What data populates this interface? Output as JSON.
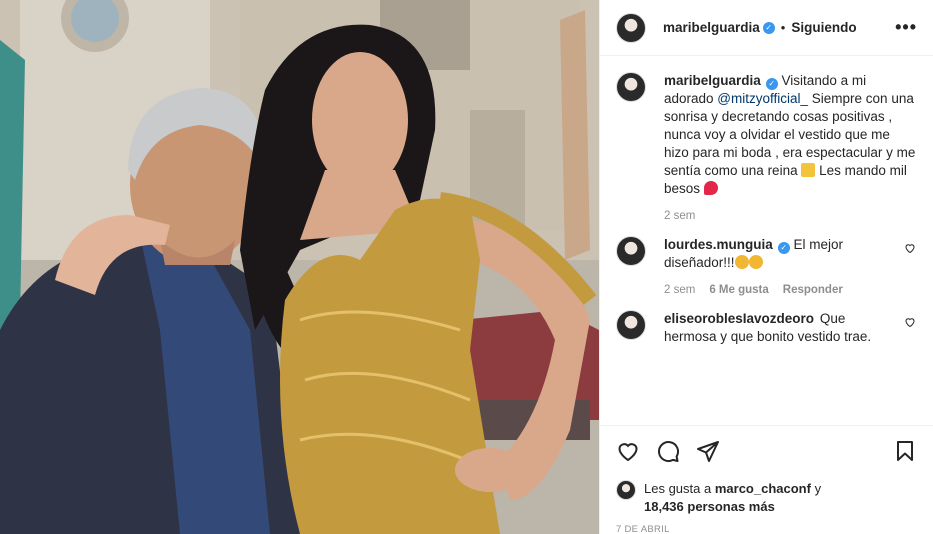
{
  "post": {
    "author": "maribelguardia",
    "follow_status": "Siguiendo",
    "separator": "•",
    "more_label": "•••",
    "verified_glyph": "✓"
  },
  "caption": {
    "username": "maribelguardia",
    "text_before": "Visitando a mi adorado ",
    "mention": "@mitzyofficial_",
    "text_after": " Siempre con una sonrisa y decretando cosas positivas , nunca voy a olvidar el vestido que me hizo para mi boda , era espectacular y me sentía como una reina ",
    "text_end": " Les mando mil besos ",
    "time": "2 sem"
  },
  "comments": [
    {
      "username": "lourdes.munguia",
      "verified": true,
      "text": "El mejor diseñador!!!",
      "time": "2 sem",
      "likes": "6 Me gusta",
      "reply": "Responder"
    },
    {
      "username": "eliseoroblesIavozdeoro",
      "verified": false,
      "text": "Que hermosa y que bonito vestido trae."
    }
  ],
  "likes": {
    "prefix": "Les gusta a",
    "user": "marco_chaconf",
    "conj": "y",
    "count": "18,436 personas más"
  },
  "date": "7 DE ABRIL",
  "colors": {
    "accent_blue": "#3897f0",
    "mention": "#00376b",
    "meta_gray": "#8e8e8e",
    "border": "#efefef"
  },
  "icons": {
    "heart": "heart-icon",
    "comment": "comment-icon",
    "share": "share-icon",
    "save": "bookmark-icon",
    "more": "more-options-icon"
  }
}
